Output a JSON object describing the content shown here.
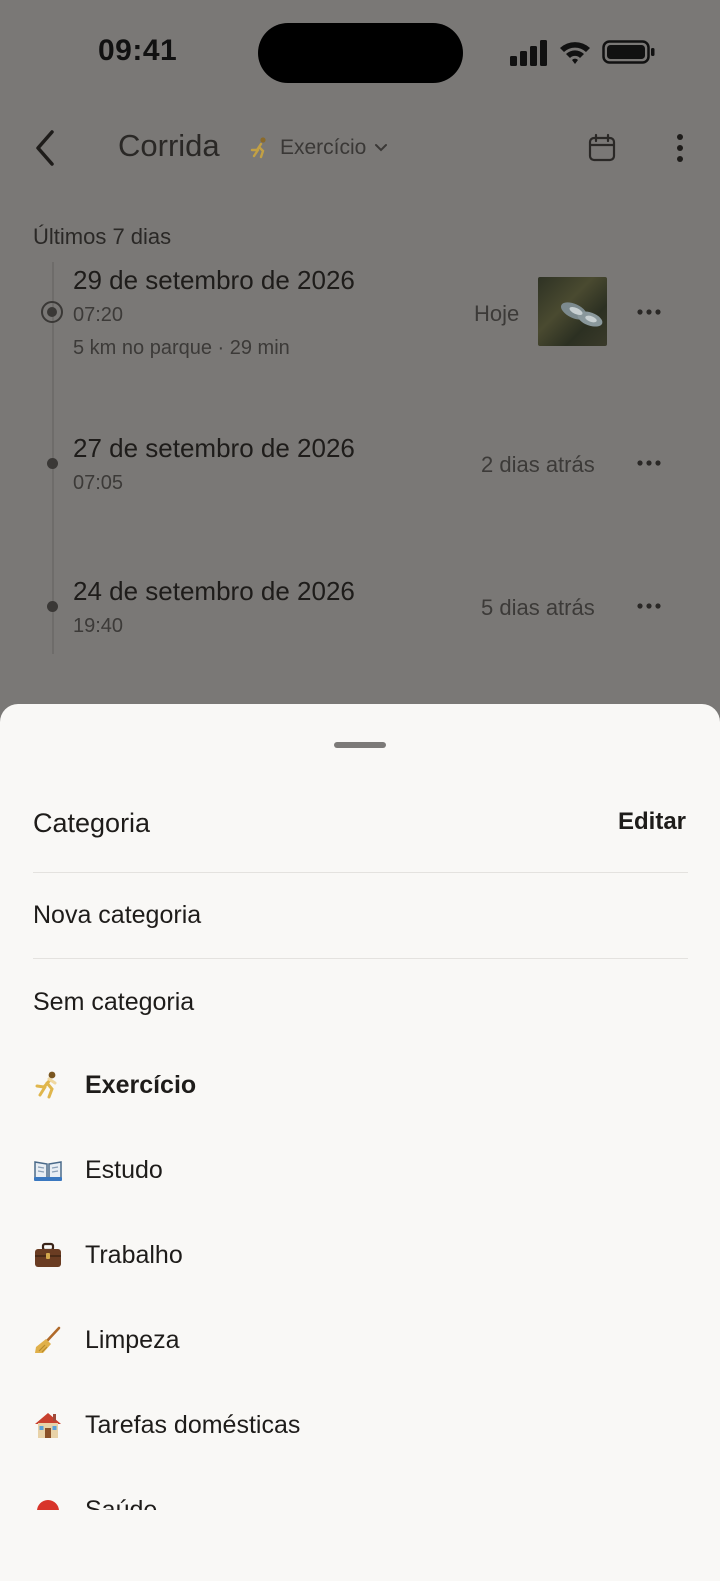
{
  "status": {
    "time": "09:41"
  },
  "header": {
    "title": "Corrida",
    "category": "Exercício"
  },
  "section_label": "Últimos 7 dias",
  "entries": [
    {
      "date": "29 de setembro de 2026",
      "time": "07:20",
      "note": "5 km no parque · 29 min",
      "relative": "Hoje"
    },
    {
      "date": "27 de setembro de 2026",
      "time": "07:05",
      "relative": "2 dias atrás"
    },
    {
      "date": "24 de setembro de 2026",
      "time": "19:40",
      "relative": "5 dias atrás"
    }
  ],
  "sheet": {
    "title": "Categoria",
    "edit_label": "Editar",
    "new_label": "Nova categoria",
    "none_label": "Sem categoria",
    "items": [
      {
        "label": "Exercício",
        "icon": "running-person-icon",
        "selected": true
      },
      {
        "label": "Estudo",
        "icon": "open-book-icon"
      },
      {
        "label": "Trabalho",
        "icon": "briefcase-icon"
      },
      {
        "label": "Limpeza",
        "icon": "broom-icon"
      },
      {
        "label": "Tarefas domésticas",
        "icon": "house-icon"
      },
      {
        "label": "Saúde",
        "icon": "health-icon"
      }
    ]
  }
}
